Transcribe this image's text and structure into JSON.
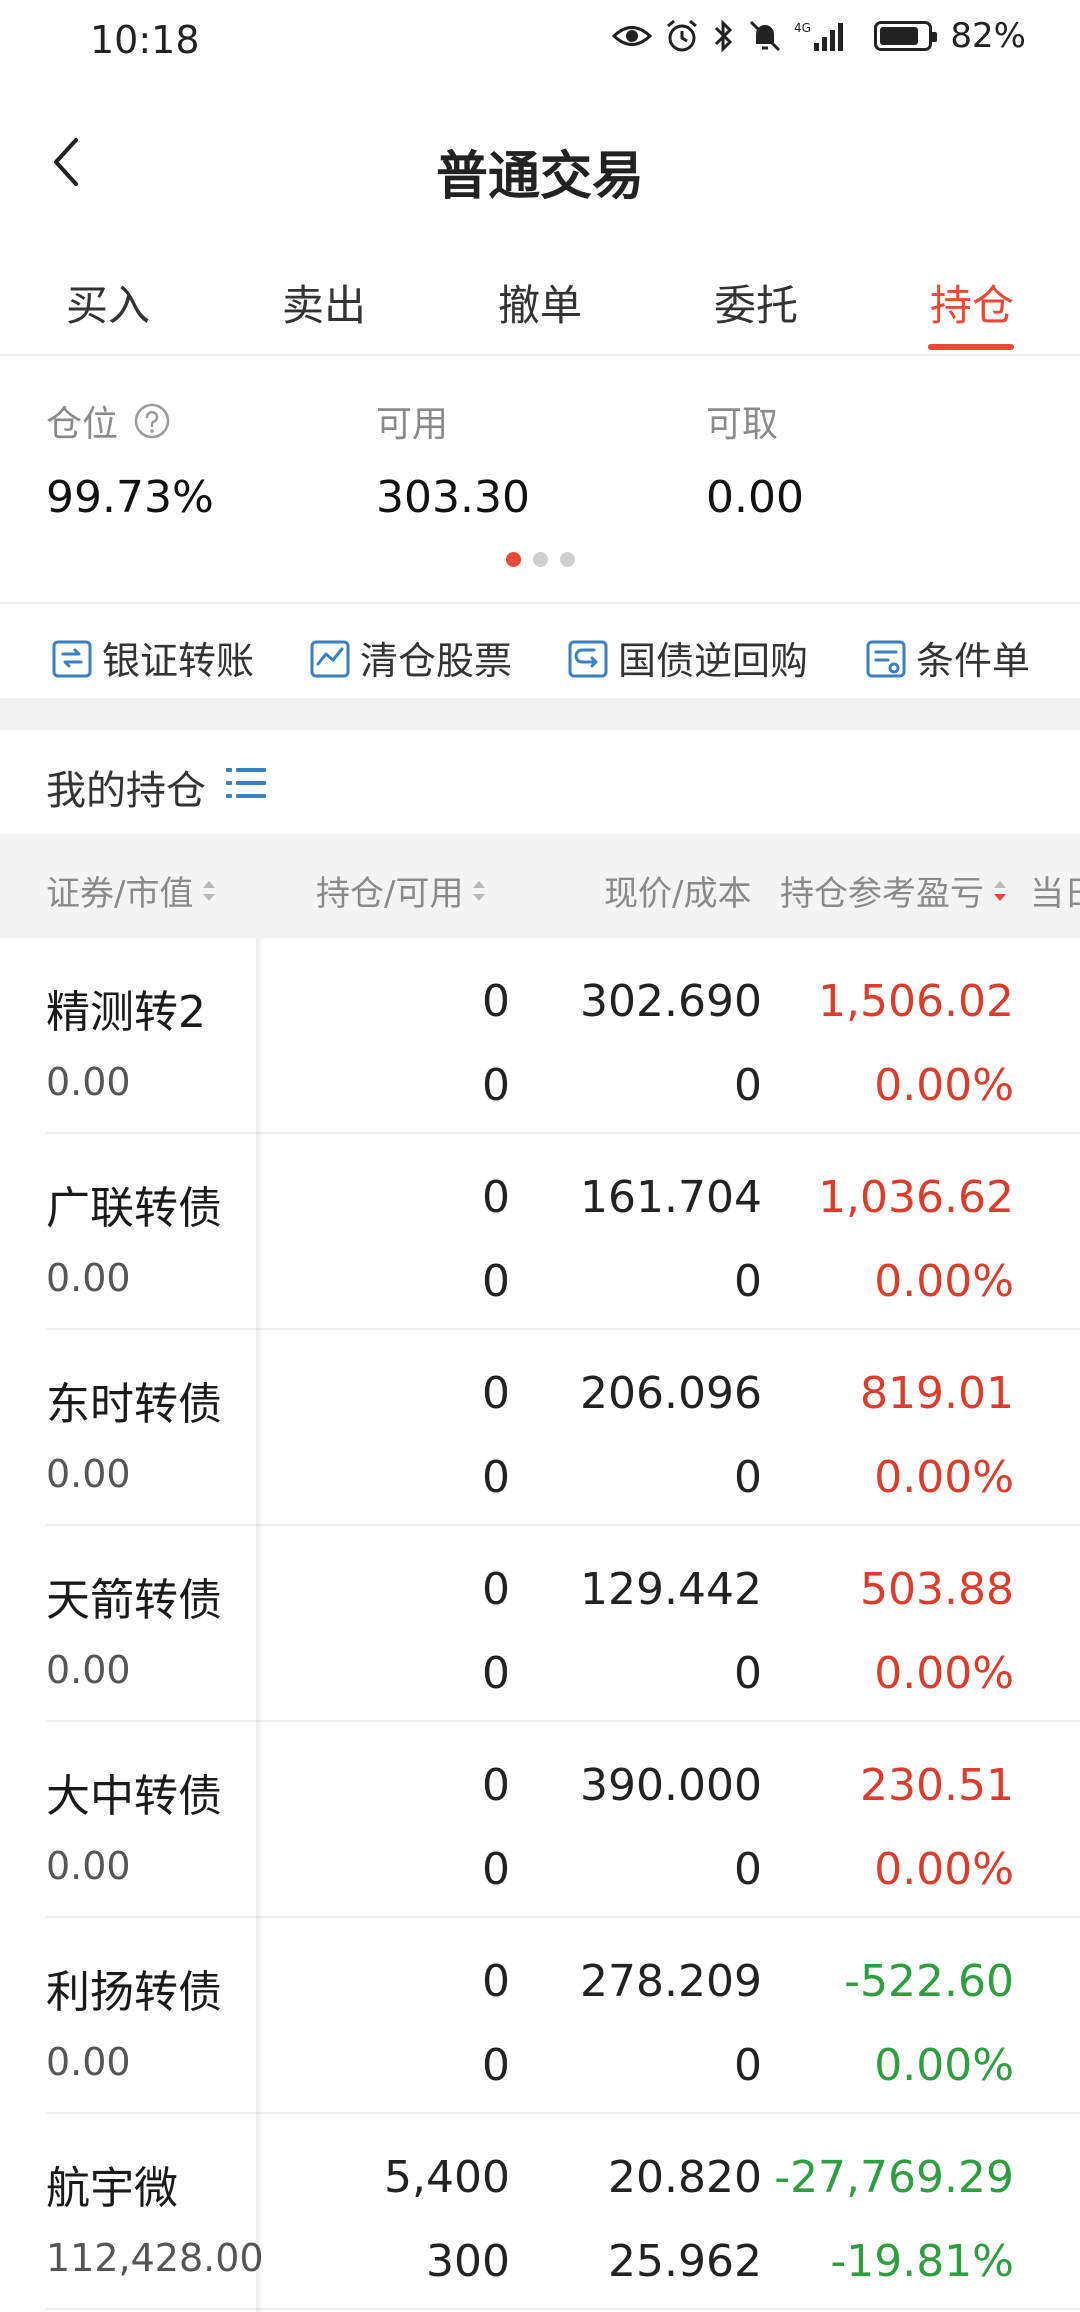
{
  "status_bar": {
    "time": "10:18",
    "battery": "82%",
    "battery_level": 0.82,
    "network_label": "4G"
  },
  "header": {
    "title": "普通交易"
  },
  "tabs": [
    {
      "label": "买入",
      "active": false
    },
    {
      "label": "卖出",
      "active": false
    },
    {
      "label": "撤单",
      "active": false
    },
    {
      "label": "委托",
      "active": false
    },
    {
      "label": "持仓",
      "active": true
    }
  ],
  "summary": {
    "position_label": "仓位",
    "position_value": "99.73%",
    "available_label": "可用",
    "available_value": "303.30",
    "withdrawable_label": "可取",
    "withdrawable_value": "0.00",
    "page_count": 3,
    "active_page": 0
  },
  "actions": [
    {
      "label": "银证转账",
      "icon": "bank-transfer-icon"
    },
    {
      "label": "清仓股票",
      "icon": "clear-stock-icon"
    },
    {
      "label": "国债逆回购",
      "icon": "reverse-repo-icon"
    },
    {
      "label": "条件单",
      "icon": "condition-order-icon"
    }
  ],
  "holdings": {
    "title": "我的持仓",
    "columns": {
      "security": "证券/市值",
      "position": "持仓/可用",
      "price": "现价/成本",
      "pnl": "持仓参考盈亏",
      "today": "当日"
    },
    "rows": [
      {
        "name": "精测转2",
        "market_value": "0.00",
        "position": "0",
        "available": "0",
        "price": "302.690",
        "cost": "0",
        "pnl": "1,506.02",
        "pnl_pct": "0.00%",
        "pnl_color": "red",
        "pct_color": "red"
      },
      {
        "name": "广联转债",
        "market_value": "0.00",
        "position": "0",
        "available": "0",
        "price": "161.704",
        "cost": "0",
        "pnl": "1,036.62",
        "pnl_pct": "0.00%",
        "pnl_color": "red",
        "pct_color": "red"
      },
      {
        "name": "东时转债",
        "market_value": "0.00",
        "position": "0",
        "available": "0",
        "price": "206.096",
        "cost": "0",
        "pnl": "819.01",
        "pnl_pct": "0.00%",
        "pnl_color": "red",
        "pct_color": "red"
      },
      {
        "name": "天箭转债",
        "market_value": "0.00",
        "position": "0",
        "available": "0",
        "price": "129.442",
        "cost": "0",
        "pnl": "503.88",
        "pnl_pct": "0.00%",
        "pnl_color": "red",
        "pct_color": "red"
      },
      {
        "name": "大中转债",
        "market_value": "0.00",
        "position": "0",
        "available": "0",
        "price": "390.000",
        "cost": "0",
        "pnl": "230.51",
        "pnl_pct": "0.00%",
        "pnl_color": "red",
        "pct_color": "red"
      },
      {
        "name": "利扬转债",
        "market_value": "0.00",
        "position": "0",
        "available": "0",
        "price": "278.209",
        "cost": "0",
        "pnl": "-522.60",
        "pnl_pct": "0.00%",
        "pnl_color": "green",
        "pct_color": "green"
      },
      {
        "name": "航宇微",
        "market_value": "112,428.00",
        "position": "5,400",
        "available": "300",
        "price": "20.820",
        "cost": "25.962",
        "pnl": "-27,769.29",
        "pnl_pct": "-19.81%",
        "pnl_color": "green",
        "pct_color": "green"
      }
    ]
  },
  "colors": {
    "accent": "#e84a35",
    "profit": "#dc3c2c",
    "loss": "#2e9e3e",
    "action_icon": "#3a7fc1"
  }
}
